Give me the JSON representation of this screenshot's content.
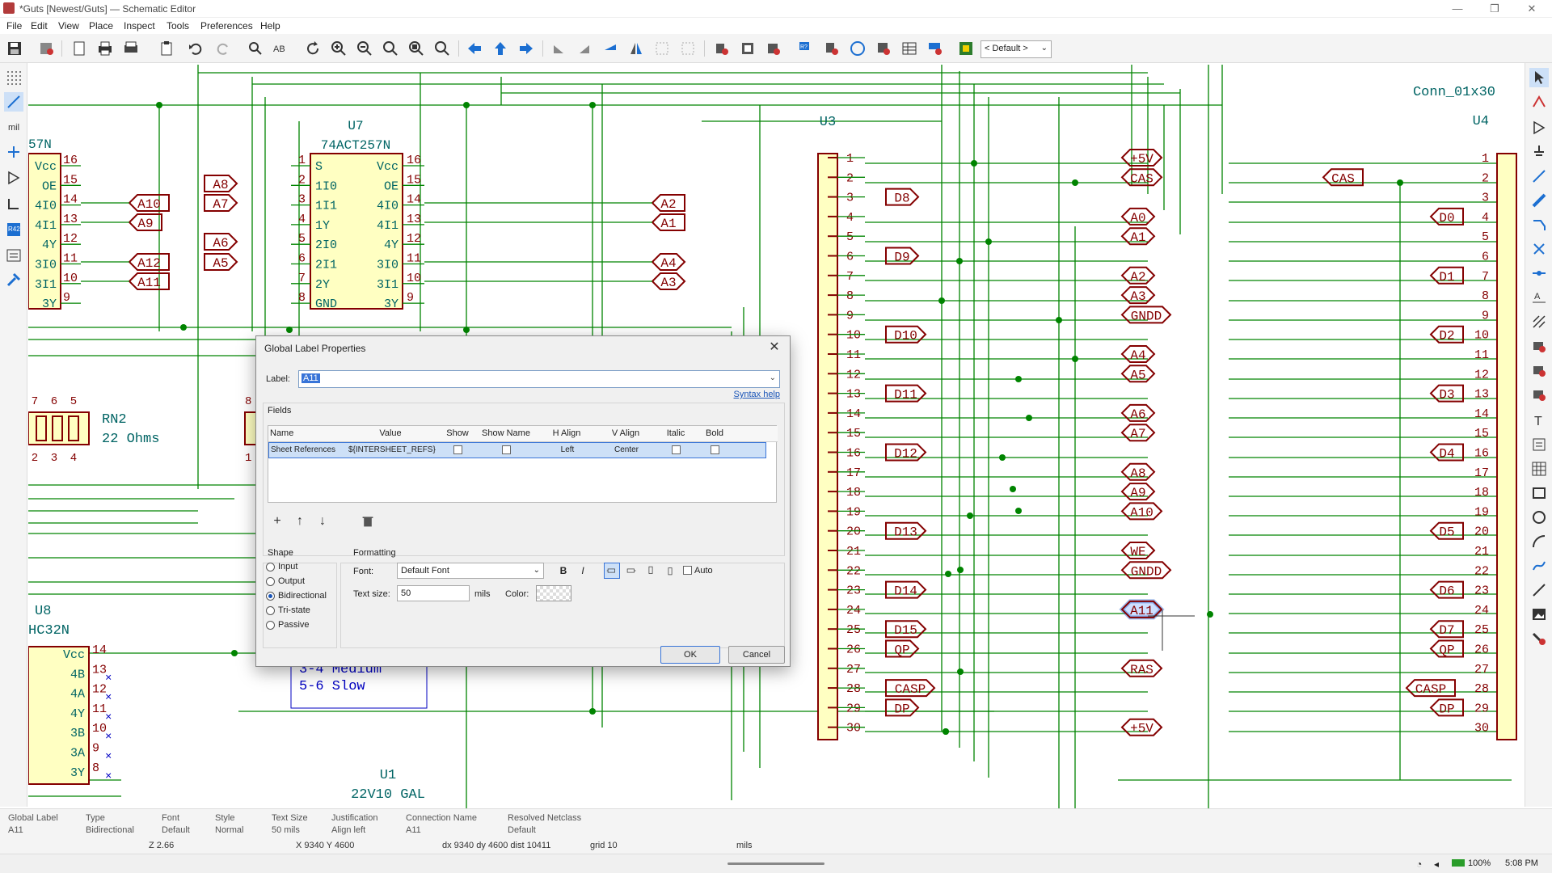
{
  "window": {
    "title": "*Guts [Newest/Guts] — Schematic Editor",
    "minimize": "—",
    "maximize": "❐",
    "close": "✕"
  },
  "menu": [
    "File",
    "Edit",
    "View",
    "Place",
    "Inspect",
    "Tools",
    "Preferences",
    "Help"
  ],
  "toolbar": {
    "view_preset": "< Default >"
  },
  "left_tools": {
    "units": "mil"
  },
  "schematic": {
    "u7": {
      "ref": "U7",
      "value": "74ACT257N",
      "left_pins": [
        "1",
        "2",
        "3",
        "4",
        "5",
        "6",
        "7",
        "8"
      ],
      "left_names": [
        "S",
        "1I0",
        "1I1",
        "1Y",
        "2I0",
        "2I1",
        "2Y",
        "GND"
      ],
      "right_pins": [
        "16",
        "15",
        "14",
        "13",
        "12",
        "11",
        "10",
        "9"
      ],
      "right_names": [
        "Vcc",
        "OE",
        "4I0",
        "4I1",
        "4Y",
        "3I0",
        "3I1",
        "3Y"
      ]
    },
    "u_left": {
      "value": "57N",
      "names": [
        "Vcc",
        "OE",
        "4I0",
        "4I1",
        "4Y",
        "3I0",
        "3I1",
        "3Y"
      ],
      "pins": [
        "16",
        "15",
        "14",
        "13",
        "12",
        "11",
        "10",
        "9"
      ]
    },
    "labels_left_a": [
      "A10",
      "A9",
      "A12",
      "A11"
    ],
    "labels_u7_left": [
      "A8",
      "A7",
      "A6",
      "A5"
    ],
    "labels_u7_right": [
      "A2",
      "A1",
      "A4",
      "A3"
    ],
    "rn2": {
      "ref": "RN2",
      "value": "22 Ohms",
      "pins_top": [
        "7",
        "6",
        "5"
      ],
      "pins_bottom": [
        "2",
        "3",
        "4"
      ],
      "pin8": "8",
      "pin1": "1"
    },
    "u8": {
      "ref": "U8",
      "value": "HC32N",
      "names": [
        "Vcc",
        "4B",
        "4A",
        "4Y",
        "3B",
        "3A",
        "3Y"
      ],
      "pins": [
        "14",
        "13",
        "12",
        "11",
        "10",
        "9",
        "8"
      ]
    },
    "u1": {
      "ref": "U1",
      "value": "22V10 GAL"
    },
    "note_lines": [
      "3-4 Medium",
      "5-6 Slow"
    ],
    "u3": {
      "ref": "U3"
    },
    "u3_pins": [
      "1",
      "2",
      "3",
      "4",
      "5",
      "6",
      "7",
      "8",
      "9",
      "10",
      "11",
      "12",
      "13",
      "14",
      "15",
      "16",
      "17",
      "18",
      "19",
      "20",
      "21",
      "22",
      "23",
      "24",
      "25",
      "26",
      "27",
      "28",
      "29",
      "30"
    ],
    "u3_labels": [
      {
        "pin": 3,
        "text": "D8"
      },
      {
        "pin": 6,
        "text": "D9"
      },
      {
        "pin": 10,
        "text": "D10"
      },
      {
        "pin": 13,
        "text": "D11"
      },
      {
        "pin": 16,
        "text": "D12"
      },
      {
        "pin": 20,
        "text": "D13"
      },
      {
        "pin": 23,
        "text": "D14"
      },
      {
        "pin": 25,
        "text": "D15"
      },
      {
        "pin": 26,
        "text": "QP"
      },
      {
        "pin": 28,
        "text": "CASP"
      },
      {
        "pin": 29,
        "text": "DP"
      }
    ],
    "mid_labels": [
      {
        "pin": 1,
        "text": "+5V"
      },
      {
        "pin": 2,
        "text": "CAS"
      },
      {
        "pin": 4,
        "text": "A0"
      },
      {
        "pin": 5,
        "text": "A1"
      },
      {
        "pin": 7,
        "text": "A2"
      },
      {
        "pin": 8,
        "text": "A3"
      },
      {
        "pin": 9,
        "text": "GNDD"
      },
      {
        "pin": 11,
        "text": "A4"
      },
      {
        "pin": 12,
        "text": "A5"
      },
      {
        "pin": 14,
        "text": "A6"
      },
      {
        "pin": 15,
        "text": "A7"
      },
      {
        "pin": 17,
        "text": "A8"
      },
      {
        "pin": 18,
        "text": "A9"
      },
      {
        "pin": 19,
        "text": "A10"
      },
      {
        "pin": 21,
        "text": "WE"
      },
      {
        "pin": 22,
        "text": "GNDD"
      },
      {
        "pin": 24,
        "text": "A11"
      },
      {
        "pin": 27,
        "text": "RAS"
      },
      {
        "pin": 30,
        "text": "+5V"
      }
    ],
    "u4": {
      "ref": "U4",
      "value": "Conn_01x30"
    },
    "u4_labels": [
      {
        "pin": 2,
        "text": "CAS"
      },
      {
        "pin": 4,
        "text": "D0"
      },
      {
        "pin": 7,
        "text": "D1"
      },
      {
        "pin": 10,
        "text": "D2"
      },
      {
        "pin": 13,
        "text": "D3"
      },
      {
        "pin": 16,
        "text": "D4"
      },
      {
        "pin": 20,
        "text": "D5"
      },
      {
        "pin": 23,
        "text": "D6"
      },
      {
        "pin": 25,
        "text": "D7"
      },
      {
        "pin": 26,
        "text": "QP"
      },
      {
        "pin": 28,
        "text": "CASP"
      },
      {
        "pin": 29,
        "text": "DP"
      }
    ]
  },
  "dialog": {
    "title": "Global Label Properties",
    "label_caption": "Label:",
    "label_value": "A11",
    "syntax_help": "Syntax help",
    "fields_title": "Fields",
    "columns": [
      "Name",
      "Value",
      "Show",
      "Show Name",
      "H Align",
      "V Align",
      "Italic",
      "Bold"
    ],
    "row": {
      "name": "Sheet References",
      "value": "${INTERSHEET_REFS}",
      "h_align": "Left",
      "v_align": "Center"
    },
    "shape_title": "Shape",
    "shapes": [
      "Input",
      "Output",
      "Bidirectional",
      "Tri-state",
      "Passive"
    ],
    "shape_selected": "Bidirectional",
    "formatting_title": "Formatting",
    "font_caption": "Font:",
    "font_value": "Default Font",
    "auto_label": "Auto",
    "text_size_caption": "Text size:",
    "text_size_value": "50",
    "text_size_unit": "mils",
    "color_caption": "Color:",
    "ok": "OK",
    "cancel": "Cancel"
  },
  "message_panel": [
    {
      "title": "Global Label",
      "value": "A11"
    },
    {
      "title": "Type",
      "value": "Bidirectional"
    },
    {
      "title": "Font",
      "value": "Default"
    },
    {
      "title": "Style",
      "value": "Normal"
    },
    {
      "title": "Text Size",
      "value": "50 mils"
    },
    {
      "title": "Justification",
      "value": "Align left"
    },
    {
      "title": "Connection Name",
      "value": "A11"
    },
    {
      "title": "Resolved Netclass",
      "value": "Default"
    }
  ],
  "status": {
    "zoom": "Z 2.66",
    "xy": "X 9340  Y 4600",
    "delta": "dx 9340  dy 4600  dist 10411",
    "grid": "grid 10",
    "units": "mils"
  },
  "taskbar": {
    "battery": "100%",
    "time": "5:08 PM"
  },
  "colors": {
    "wire": "#008400",
    "symbol": "#840000",
    "symbol_fill": "#ffffc2",
    "ref_text": "#006464",
    "label": "#840000",
    "junction": "#008400",
    "note": "#0000c2"
  }
}
